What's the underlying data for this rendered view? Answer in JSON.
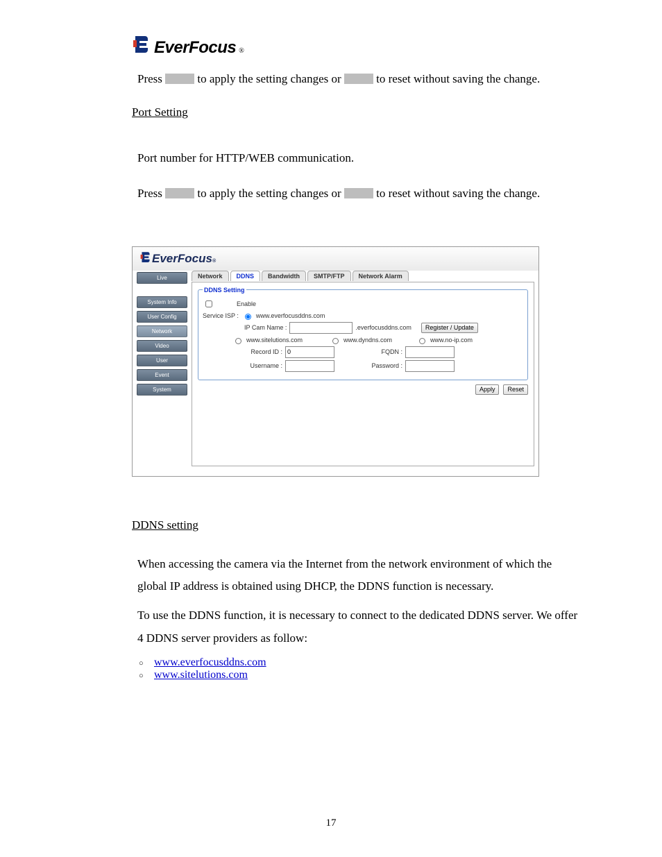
{
  "brand": {
    "name": "EverFocus",
    "reg": "®"
  },
  "text": {
    "press1_a": "Press ",
    "press1_b": " to apply the setting changes or ",
    "press1_c": " to reset without saving the change.",
    "port_title": "Port Setting",
    "port_desc": "Port number for HTTP/WEB communication.",
    "press2_a": "Press ",
    "press2_b": " to apply the setting changes or ",
    "press2_c": " to reset without saving the change.",
    "ddns_title": "DDNS setting",
    "ddns_p1": "When accessing the camera via the Internet from the network environment of which the global IP address is obtained using DHCP, the DDNS function is necessary.",
    "ddns_p2": "To use the DDNS function, it is necessary to connect to the dedicated DDNS server. We offer 4 DDNS server providers as follow:",
    "link1": "www.everfocusddns.com",
    "link2": "www.sitelutions.com",
    "pagenum": "17"
  },
  "ui": {
    "sidebar": {
      "live": "Live",
      "sysinfo": "System Info",
      "userconfig": "User Config",
      "network": "Network",
      "video": "Video",
      "user": "User",
      "event": "Event",
      "system": "System"
    },
    "tabs": {
      "network": "Network",
      "ddns": "DDNS",
      "bandwidth": "Bandwidth",
      "smtp": "SMTP/FTP",
      "alarm": "Network Alarm"
    },
    "ddns": {
      "legend": "DDNS Setting",
      "enable": "Enable",
      "service_isp": "Service ISP :",
      "svc1": "www.everfocusddns.com",
      "ipcam_label": "IP Cam Name :",
      "domain_suffix": ".everfocusddns.com",
      "register": "Register / Update",
      "svc2": "www.sitelutions.com",
      "svc3": "www.dyndns.com",
      "svc4": "www.no-ip.com",
      "recordid": "Record ID :",
      "recordid_val": "0",
      "fqdn": "FQDN :",
      "username": "Username :",
      "password": "Password :",
      "apply": "Apply",
      "reset": "Reset"
    }
  }
}
